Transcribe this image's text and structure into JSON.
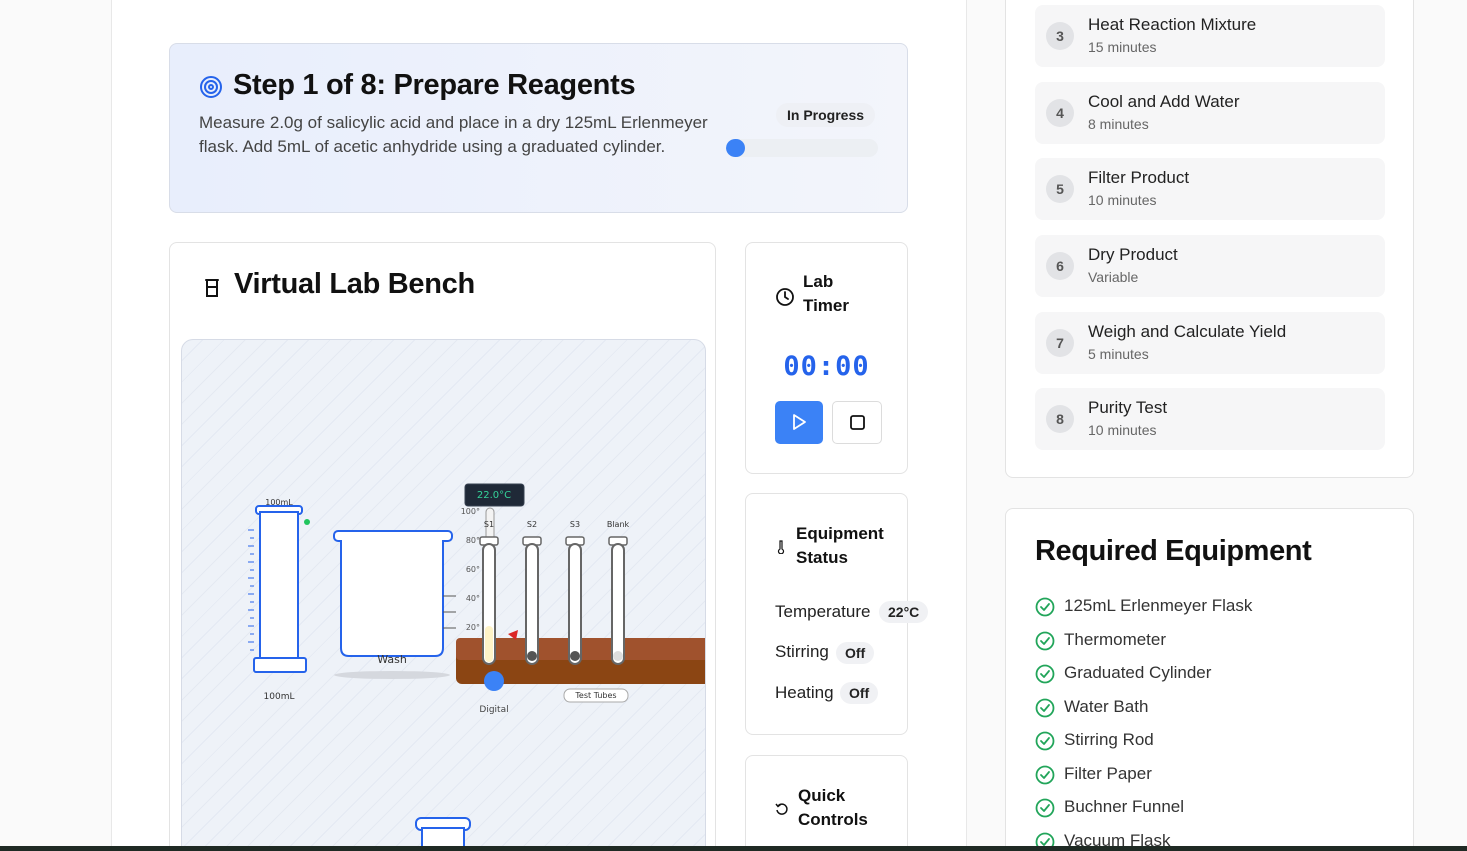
{
  "step": {
    "title": "Step 1 of 8: Prepare Reagents",
    "description": "Measure 2.0g of salicylic acid and place in a dry 125mL Erlenmeyer flask. Add 5mL of acetic anhydride using a graduated cylinder.",
    "status": "In Progress",
    "progress": 0.125
  },
  "bench": {
    "title": "Virtual Lab Bench",
    "cylinder_top_label": "100mL",
    "cylinder_bottom_label": "100mL",
    "beaker_label": "Wash",
    "thermometer_readout": "22.0°C",
    "thermometer_scale": [
      "100°",
      "80°",
      "60°",
      "40°",
      "20°"
    ],
    "thermometer_label": "Digital",
    "tube_labels": [
      "S1",
      "S2",
      "S3",
      "Blank"
    ],
    "rack_label": "Test Tubes"
  },
  "timer": {
    "title_line1": "Lab",
    "title_line2": "Timer",
    "display": "00:00"
  },
  "equipment_status": {
    "title_line1": "Equipment",
    "title_line2": "Status",
    "temperature_label": "Temperature",
    "temperature_value": "22°C",
    "stirring_label": "Stirring",
    "stirring_value": "Off",
    "heating_label": "Heating",
    "heating_value": "Off"
  },
  "quick_controls": {
    "title_line1": "Quick",
    "title_line2": "Controls"
  },
  "procedure": [
    {
      "num": "3",
      "title": "Heat Reaction Mixture",
      "duration": "15 minutes"
    },
    {
      "num": "4",
      "title": "Cool and Add Water",
      "duration": "8 minutes"
    },
    {
      "num": "5",
      "title": "Filter Product",
      "duration": "10 minutes"
    },
    {
      "num": "6",
      "title": "Dry Product",
      "duration": "Variable"
    },
    {
      "num": "7",
      "title": "Weigh and Calculate Yield",
      "duration": "5 minutes"
    },
    {
      "num": "8",
      "title": "Purity Test",
      "duration": "10 minutes"
    }
  ],
  "required_equipment": {
    "title": "Required Equipment",
    "items": [
      "125mL Erlenmeyer Flask",
      "Thermometer",
      "Graduated Cylinder",
      "Water Bath",
      "Stirring Rod",
      "Filter Paper",
      "Buchner Funnel",
      "Vacuum Flask"
    ]
  },
  "colors": {
    "accent": "#3b82f6",
    "timer_text": "#2563eb",
    "check": "#22a55a",
    "bench_wood": "#a0522d"
  }
}
